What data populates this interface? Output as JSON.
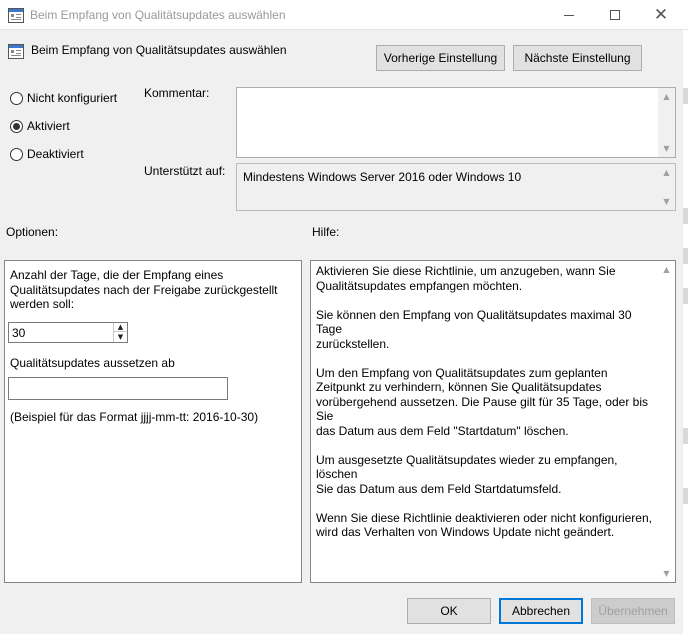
{
  "window": {
    "title": "Beim Empfang von Qualitätsupdates auswählen"
  },
  "header": {
    "policy_title": "Beim Empfang von Qualitätsupdates auswählen",
    "prev_button": "Vorherige Einstellung",
    "next_button": "Nächste Einstellung"
  },
  "state": {
    "options": [
      {
        "label": "Nicht konfiguriert",
        "checked": false
      },
      {
        "label": "Aktiviert",
        "checked": true
      },
      {
        "label": "Deaktiviert",
        "checked": false
      }
    ]
  },
  "comment": {
    "label": "Kommentar:",
    "value": ""
  },
  "supported": {
    "label": "Unterstützt auf:",
    "value": "Mindestens Windows Server 2016 oder Windows 10"
  },
  "options_section": {
    "label": "Optionen:",
    "defer_label_lines": [
      "Anzahl der Tage, die der Empfang eines",
      "Qualitätsupdates nach der Freigabe zurückgestellt",
      "werden soll:"
    ],
    "defer_days": "30",
    "pause_label": "Qualitätsupdates aussetzen ab",
    "pause_date": "",
    "format_hint": "(Beispiel für das Format jjjj-mm-tt: 2016-10-30)"
  },
  "help_section": {
    "label": "Hilfe:",
    "paragraphs": [
      [
        "Aktivieren Sie diese Richtlinie, um anzugeben, wann Sie",
        "Qualitätsupdates empfangen möchten."
      ],
      [
        "Sie können den Empfang von Qualitätsupdates maximal 30 Tage",
        "zurückstellen."
      ],
      [
        "Um den Empfang von Qualitätsupdates zum geplanten",
        "Zeitpunkt zu verhindern, können Sie Qualitätsupdates",
        "vorübergehend aussetzen. Die Pause gilt für 35 Tage, oder bis Sie",
        "das Datum aus dem Feld \"Startdatum\" löschen."
      ],
      [
        "Um ausgesetzte Qualitätsupdates wieder zu empfangen, löschen",
        "Sie das Datum aus dem Feld Startdatumsfeld."
      ],
      [
        "Wenn Sie diese Richtlinie deaktivieren oder nicht konfigurieren,",
        "wird das Verhalten von Windows Update nicht geändert."
      ]
    ]
  },
  "footer": {
    "ok": "OK",
    "cancel": "Abbrechen",
    "apply": "Übernehmen"
  },
  "icons": {
    "app": "policy-window-icon",
    "minimize": "minimize-icon",
    "maximize": "maximize-icon",
    "close": "close-icon"
  }
}
